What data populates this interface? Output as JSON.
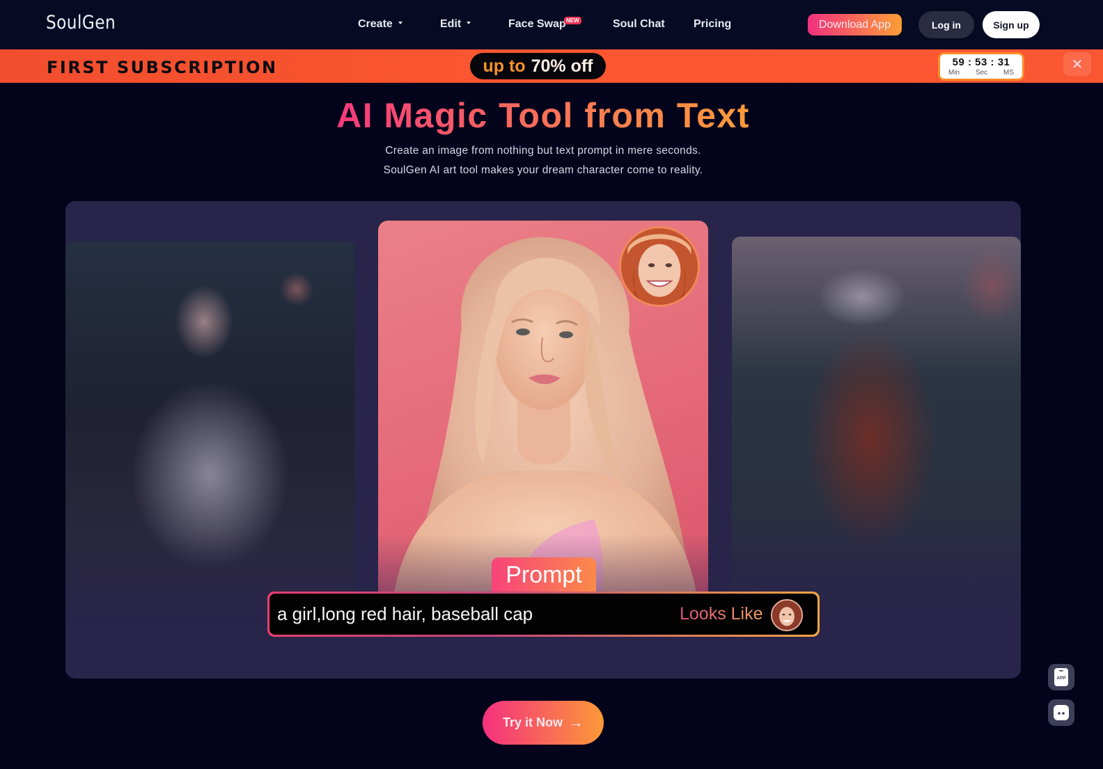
{
  "navbar": {
    "logo": "SoulGen",
    "items": [
      {
        "label": "Create",
        "has_dropdown": true
      },
      {
        "label": "Edit",
        "has_dropdown": true
      },
      {
        "label": "Face Swap",
        "badge": "NEW"
      },
      {
        "label": "Soul Chat"
      },
      {
        "label": "Pricing"
      }
    ],
    "download_label": "Download App",
    "login_label": "Log in",
    "signup_label": "Sign up"
  },
  "promo": {
    "title": "FIRST SUBSCRIPTION",
    "pill_prefix": "up to",
    "pill_value": "70% off",
    "timer": {
      "min": "59",
      "sec": "53",
      "ms": "31",
      "separator": ":",
      "labels": [
        "Min",
        "Sec",
        "MS"
      ]
    },
    "close_icon": "✕"
  },
  "hero": {
    "title": "AI Magic Tool from Text",
    "subtitle_lines": [
      "Create an image from nothing but text prompt in mere seconds.",
      "SoulGen AI art tool makes your dream character come to reality."
    ]
  },
  "showcase": {
    "prompt_tag": "Prompt",
    "prompt_text": "a girl,long red hair, baseball cap",
    "looks_like_label": "Looks Like"
  },
  "cta": {
    "label": "Try it Now",
    "arrow": "→"
  },
  "floating": {
    "app_label": "APP"
  },
  "colors": {
    "background": "#03041c",
    "promo_orange": "#fc5730",
    "accent_pink": "#f5317e",
    "accent_orange": "#fb9938",
    "showcase_bg": "#28244a"
  }
}
